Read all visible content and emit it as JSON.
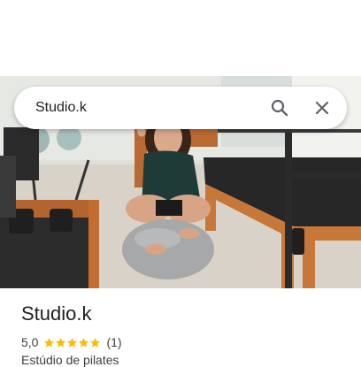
{
  "search": {
    "query": "Studio.k"
  },
  "icons": {
    "search": "search-icon",
    "close": "close-icon",
    "star": "star-icon"
  },
  "place": {
    "name": "Studio.k",
    "rating": "5,0",
    "stars": 5,
    "review_count": "(1)",
    "category": "Estúdio de pilates"
  },
  "colors": {
    "star": "#fbbc04",
    "text": "#202124",
    "secondary_text": "#3c4043"
  }
}
